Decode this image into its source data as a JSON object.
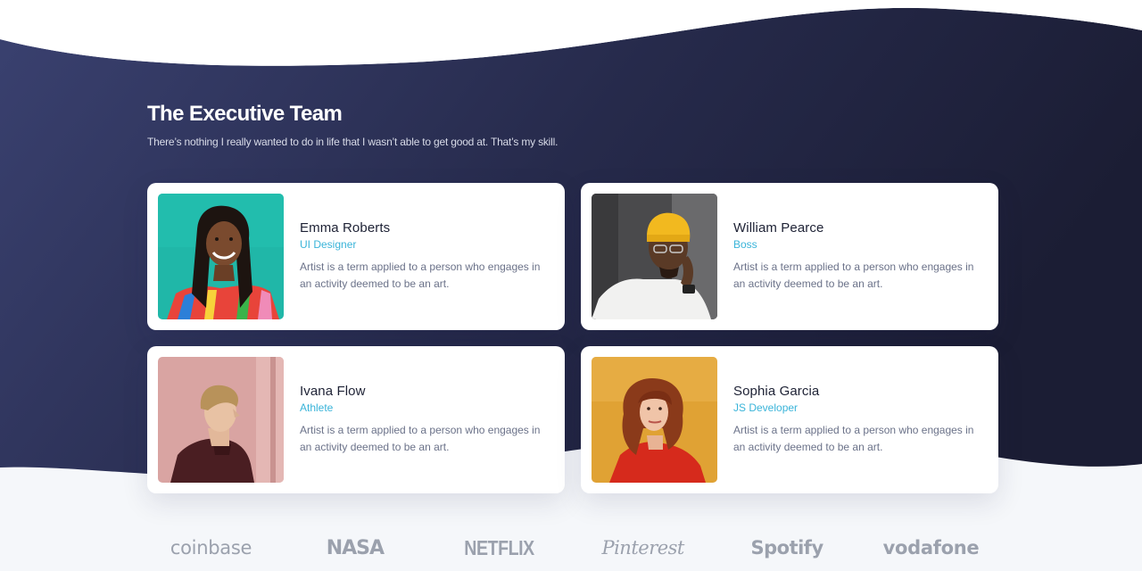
{
  "colors": {
    "hero_left": "#3a4170",
    "hero_right": "#1c1e36",
    "page_bg": "#f5f7fa",
    "accent": "#3ab4d9",
    "card_bg": "#ffffff",
    "logo_gray": "#9ba1ad"
  },
  "team": {
    "title": "The Executive Team",
    "subtitle": "There’s nothing I really wanted to do in life that I wasn’t able to get good at. That’s my skill.",
    "members": [
      {
        "name": "Emma Roberts",
        "role": "UI Designer",
        "description": "Artist is a term applied to a person who engages in an activity deemed to be an art.",
        "photo_icon": "portrait-woman-braids"
      },
      {
        "name": "William Pearce",
        "role": "Boss",
        "description": "Artist is a term applied to a person who engages in an activity deemed to be an art.",
        "photo_icon": "portrait-man-yellow-beanie"
      },
      {
        "name": "Ivana Flow",
        "role": "Athlete",
        "description": "Artist is a term applied to a person who engages in an activity deemed to be an art.",
        "photo_icon": "portrait-man-profile"
      },
      {
        "name": "Sophia Garcia",
        "role": "JS Developer",
        "description": "Artist is a term applied to a person who engages in an activity deemed to be an art.",
        "photo_icon": "portrait-woman-curly-hair"
      }
    ]
  },
  "logos": [
    {
      "name": "coinbase",
      "text": "coinbase"
    },
    {
      "name": "nasa",
      "text": "NASA"
    },
    {
      "name": "netflix",
      "text": "NETFLIX"
    },
    {
      "name": "pinterest",
      "text": "Pinterest"
    },
    {
      "name": "spotify",
      "text": "Spotify"
    },
    {
      "name": "vodafone",
      "text": "vodafone"
    }
  ]
}
